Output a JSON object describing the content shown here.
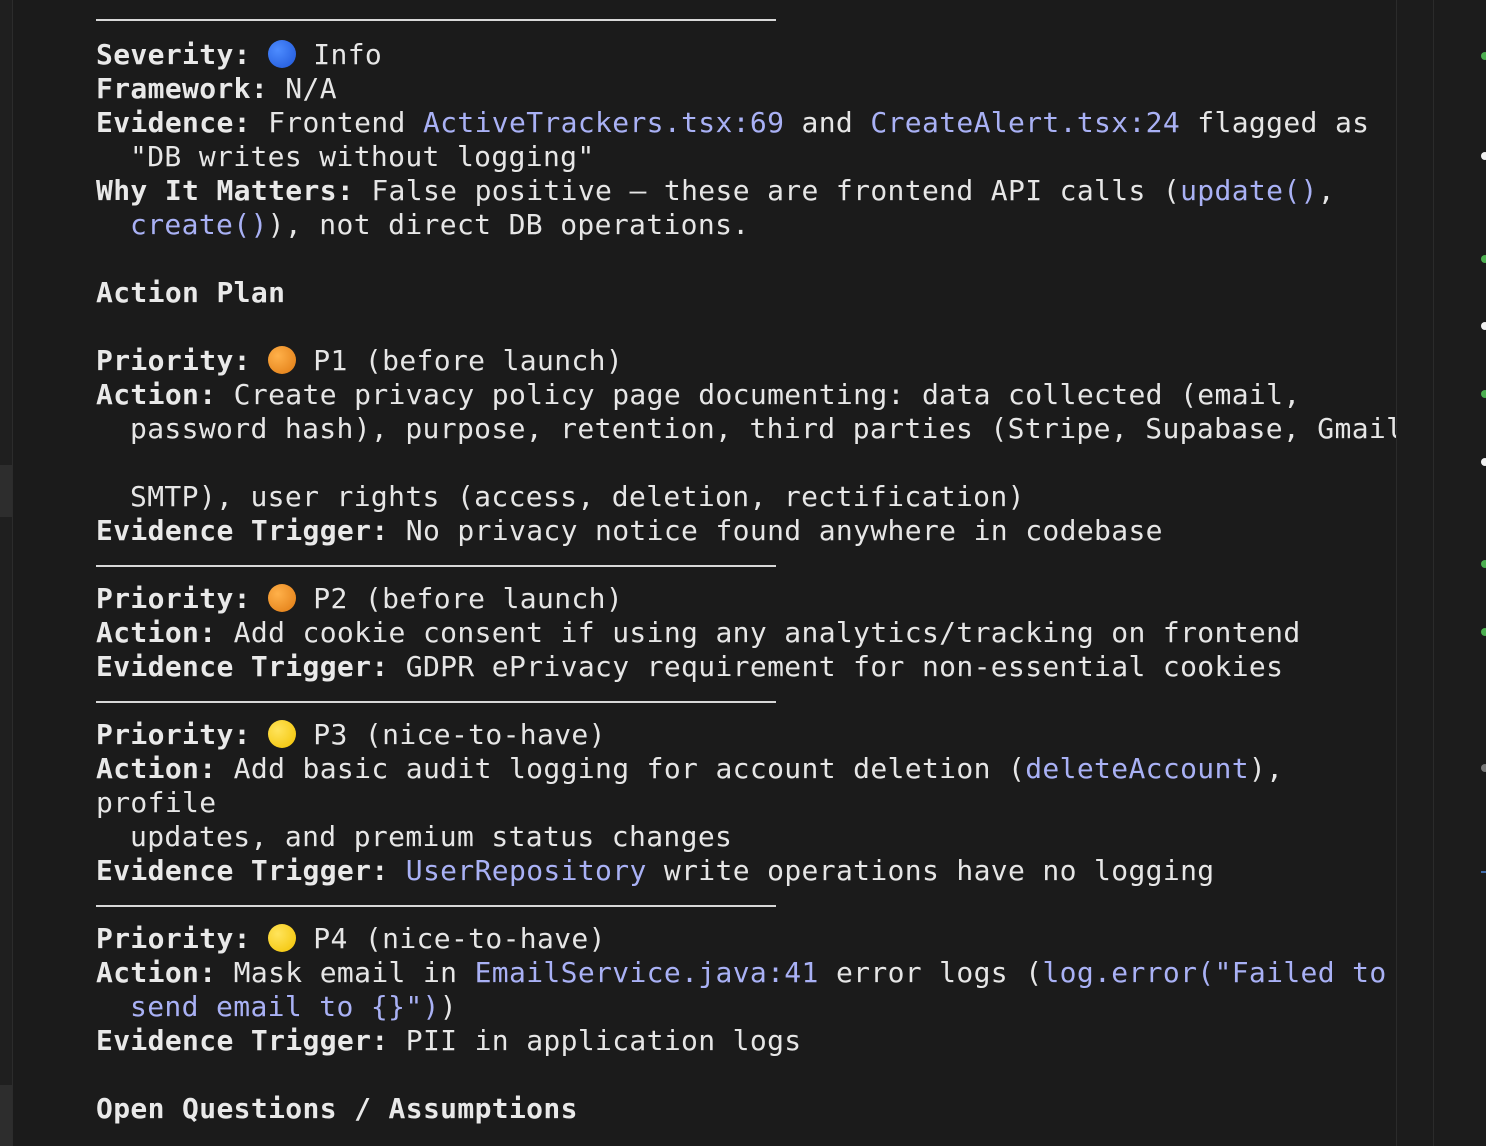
{
  "colors": {
    "background": "#1b1b1b",
    "text": "#e6e6e6",
    "code_link": "#a9b1f5",
    "severity_info": "#2f6cf0",
    "priority_orange": "#f0941f",
    "priority_yellow": "#f7d21a"
  },
  "finding": {
    "severity_label": "Severity:",
    "severity_icon": "blue-circle-icon",
    "severity_value": " Info",
    "framework_label": "Framework:",
    "framework_value": " N/A",
    "evidence_label": "Evidence:",
    "evidence_pre": " Frontend ",
    "evidence_file1": "ActiveTrackers.tsx:69",
    "evidence_mid": " and ",
    "evidence_file2": "CreateAlert.tsx:24",
    "evidence_post": " flagged as",
    "evidence_line2": "\"DB writes without logging\"",
    "why_label": "Why It Matters:",
    "why_pre": " False positive — these are frontend API calls (",
    "why_code1": "update()",
    "why_post1": ",",
    "why_code2": "create()",
    "why_post2": "), not direct DB operations."
  },
  "action_plan_heading": "Action Plan",
  "priorities": [
    {
      "priority_label": "Priority:",
      "icon": "orange-circle-icon",
      "priority_value": " P1 (before launch)",
      "action_label": "Action:",
      "action_line1": " Create privacy policy page documenting: data collected (email,",
      "action_line2": "password hash), purpose, retention, third parties (Stripe, Supabase, Gmail",
      "action_line3": "SMTP), user rights (access, deletion, rectification)",
      "trigger_label": "Evidence Trigger:",
      "trigger_value": " No privacy notice found anywhere in codebase"
    },
    {
      "priority_label": "Priority:",
      "icon": "orange-circle-icon",
      "priority_value": " P2 (before launch)",
      "action_label": "Action:",
      "action_line1": " Add cookie consent if using any analytics/tracking on frontend",
      "trigger_label": "Evidence Trigger:",
      "trigger_value": " GDPR ePrivacy requirement for non-essential cookies"
    },
    {
      "priority_label": "Priority:",
      "icon": "yellow-circle-icon",
      "priority_value": " P3 (nice-to-have)",
      "action_label": "Action:",
      "action_pre": " Add basic audit logging for account deletion (",
      "action_code": "deleteAccount",
      "action_post": "),",
      "action_line2": "profile",
      "action_line3": "updates, and premium status changes",
      "trigger_label": "Evidence Trigger:",
      "trigger_code": "UserRepository",
      "trigger_value": " write operations have no logging"
    },
    {
      "priority_label": "Priority:",
      "icon": "yellow-circle-icon",
      "priority_value": " P4 (nice-to-have)",
      "action_label": "Action:",
      "action_pre": " Mask email in ",
      "action_code1": "EmailService.java:41",
      "action_mid": " error logs (",
      "action_code2": "log.error(\"Failed to",
      "action_code3": "send email to {}\")",
      "action_post": ")",
      "trigger_label": "Evidence Trigger:",
      "trigger_value": " PII in application logs"
    }
  ],
  "open_questions_heading": "Open Questions / Assumptions"
}
